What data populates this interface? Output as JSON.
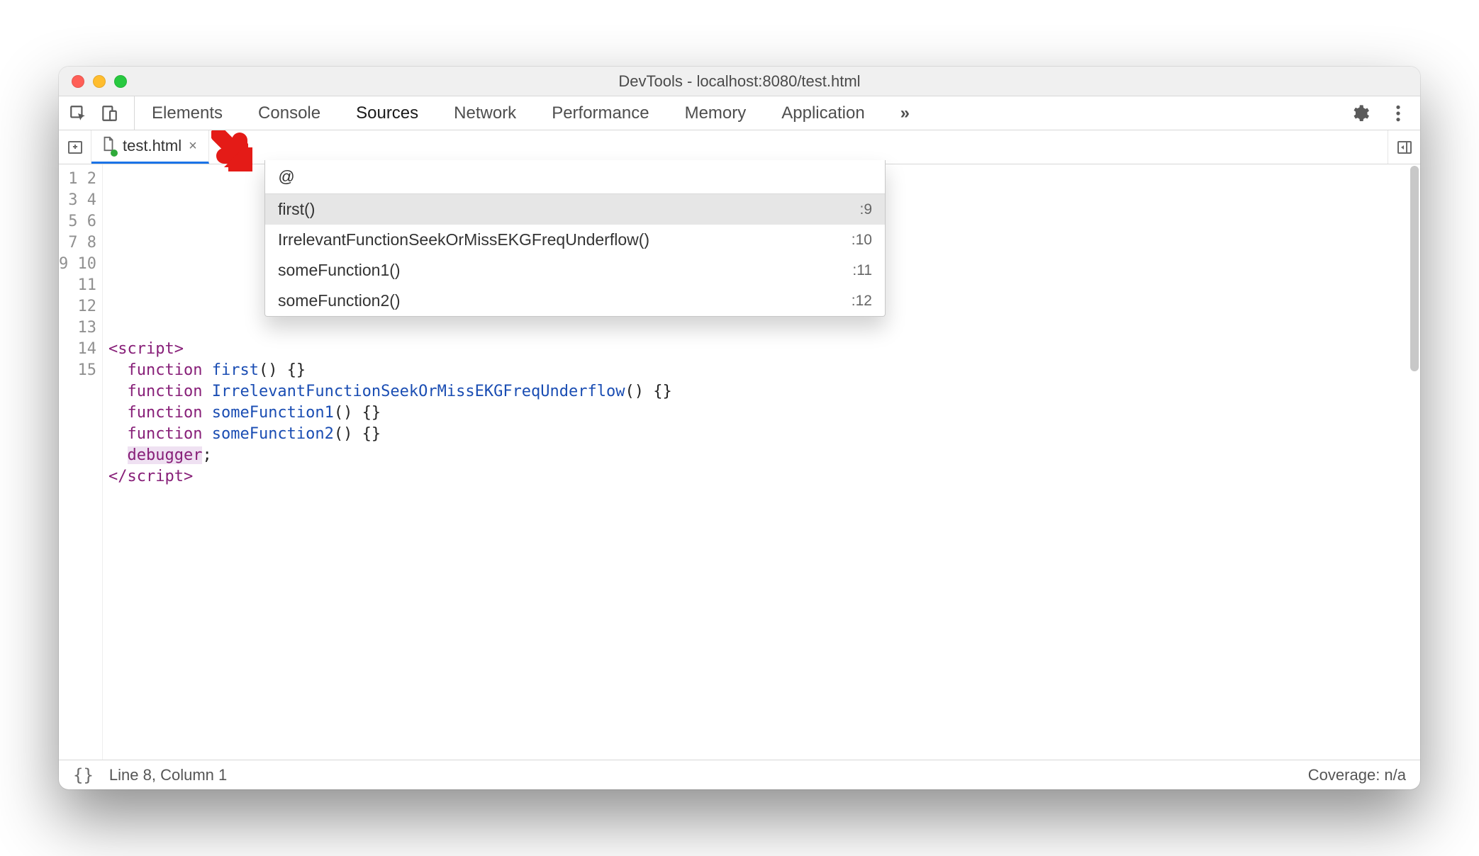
{
  "window": {
    "title": "DevTools - localhost:8080/test.html"
  },
  "tabs": {
    "items": [
      {
        "label": "Elements"
      },
      {
        "label": "Console"
      },
      {
        "label": "Sources"
      },
      {
        "label": "Network"
      },
      {
        "label": "Performance"
      },
      {
        "label": "Memory"
      },
      {
        "label": "Application"
      }
    ],
    "active_index": 2,
    "overflow_glyph": "»"
  },
  "filetab": {
    "name": "test.html",
    "close_glyph": "×"
  },
  "quickopen": {
    "query": "@",
    "results": [
      {
        "label": "first()",
        "line": ":9"
      },
      {
        "label": "IrrelevantFunctionSeekOrMissEKGFreqUnderflow()",
        "line": ":10"
      },
      {
        "label": "someFunction1()",
        "line": ":11"
      },
      {
        "label": "someFunction2()",
        "line": ":12"
      }
    ],
    "selected_index": 0
  },
  "editor": {
    "line_count": 15,
    "lines": {
      "l8_open": "<script>",
      "l9_kw": "function",
      "l9_fn": "first",
      "l9_rest": "() {}",
      "l10_kw": "function",
      "l10_fn": "IrrelevantFunctionSeekOrMissEKGFreqUnderflow",
      "l10_rest": "() {}",
      "l11_kw": "function",
      "l11_fn": "someFunction1",
      "l11_rest": "() {}",
      "l12_kw": "function",
      "l12_fn": "someFunction2",
      "l12_rest": "() {}",
      "l13_kw": "debugger",
      "l13_rest": ";",
      "l14_close_open": "</",
      "l14_close_name": "script",
      "l14_close_end": ">"
    }
  },
  "statusbar": {
    "braces": "{}",
    "position": "Line 8, Column 1",
    "coverage": "Coverage: n/a"
  }
}
